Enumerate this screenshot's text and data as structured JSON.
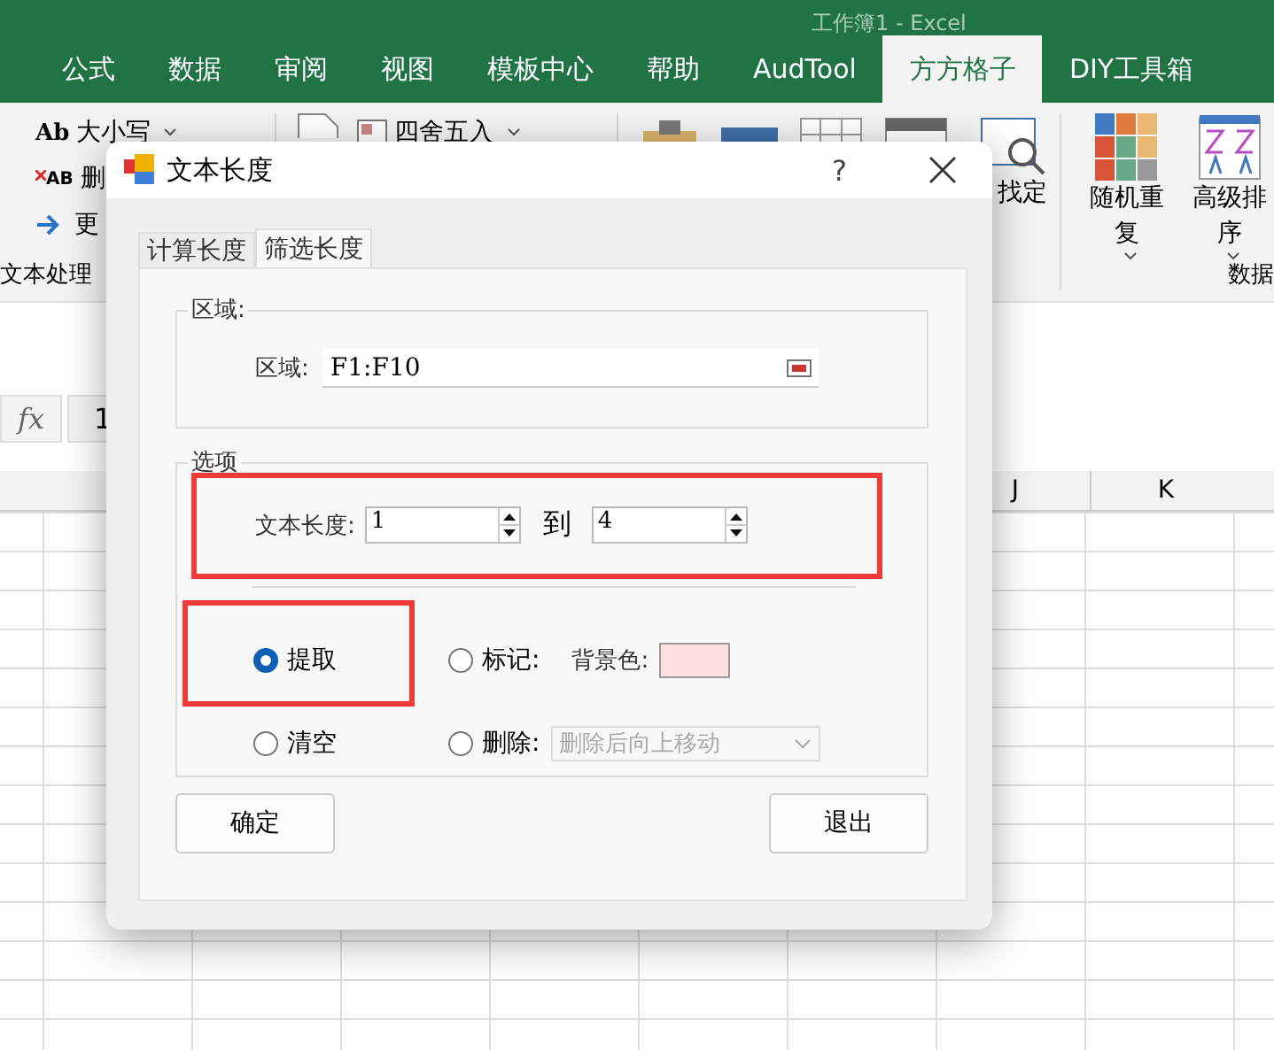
{
  "excel": {
    "title": "工作簿1 - Excel",
    "tabs": [
      {
        "label": "公式",
        "selected": false
      },
      {
        "label": "数据",
        "selected": false
      },
      {
        "label": "审阅",
        "selected": false
      },
      {
        "label": "视图",
        "selected": false
      },
      {
        "label": "模板中心",
        "selected": false
      },
      {
        "label": "帮助",
        "selected": false
      },
      {
        "label": "AudTool",
        "selected": false
      },
      {
        "label": "方方格子",
        "selected": true
      },
      {
        "label": "DIY工具箱",
        "selected": false
      }
    ],
    "text_group": {
      "items": [
        {
          "kind": "case",
          "icon_text": "Ab",
          "label": "大小写"
        },
        {
          "kind": "delete",
          "icon_text": "AB",
          "label": "删"
        },
        {
          "kind": "more",
          "label": "更"
        }
      ],
      "label": "文本处理"
    },
    "round": {
      "label": "四舍五入"
    },
    "find": {
      "label": "找定"
    },
    "data_group": {
      "items": [
        {
          "kind": "shuffle",
          "lines": [
            "随机重",
            "复"
          ]
        },
        {
          "kind": "sort",
          "lines": [
            "高级排",
            "序"
          ]
        }
      ],
      "label": "数据"
    },
    "formula_bar": {
      "fx": "fx",
      "name_box": "1"
    },
    "column_headers": [
      "J",
      "K"
    ]
  },
  "dialog": {
    "title": "文本长度",
    "help": "?",
    "tabs": [
      {
        "label": "计算长度",
        "selected": false
      },
      {
        "label": "筛选长度",
        "selected": true
      }
    ],
    "range_group": {
      "title": "区域:",
      "label": "区域:",
      "value": "F1:F10"
    },
    "options_group": {
      "title": "选项",
      "length_label": "文本长度:",
      "from": "1",
      "to_label": "到",
      "to": "4",
      "modes": [
        {
          "kind": "extract",
          "label": "提取",
          "selected": true
        },
        {
          "kind": "mark",
          "label": "标记:",
          "selected": false
        },
        {
          "kind": "clear",
          "label": "清空",
          "selected": false
        },
        {
          "kind": "delete",
          "label": "删除:",
          "selected": false
        }
      ],
      "background": {
        "label": "背景色:",
        "color": "#ffe1e0"
      },
      "delete_mode": {
        "value": "删除后向上移动",
        "disabled": true
      }
    },
    "buttons": [
      "确定",
      "退出"
    ]
  }
}
